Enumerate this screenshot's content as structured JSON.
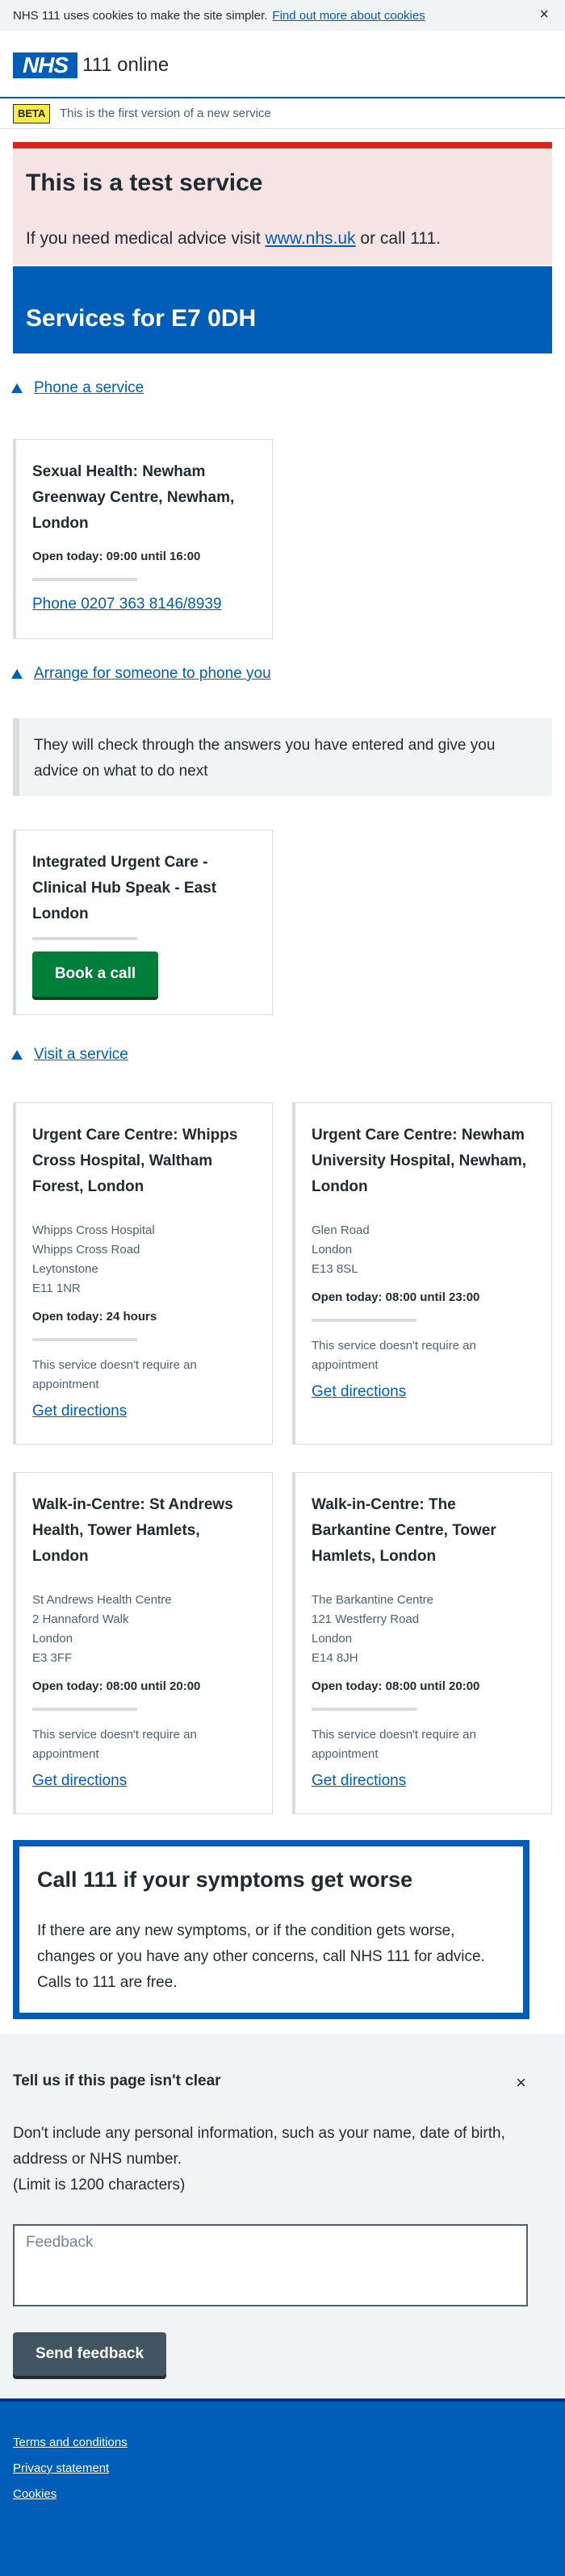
{
  "cookie_banner": {
    "text": "NHS 111 uses cookies to make the site simpler.",
    "link": "Find out more about cookies",
    "close": "×"
  },
  "header": {
    "logo": "NHS",
    "service_name": "111 online"
  },
  "beta": {
    "tag": "BETA",
    "text": "This is the first version of a new service"
  },
  "test_panel": {
    "title": "This is a test service",
    "text_before": "If you need medical advice visit",
    "link": "www.nhs.uk",
    "text_after": "or call 111."
  },
  "services_heading": "Services for E7 0DH",
  "phone_section": {
    "toggle": "Phone a service",
    "card": {
      "title": "Sexual Health: Newham Greenway Centre, Newham, London",
      "open": "Open today: 09:00 until 16:00",
      "phone_link": "Phone 0207 363 8146/8939"
    }
  },
  "arrange_section": {
    "toggle": "Arrange for someone to phone you",
    "inset": "They will check through the answers you have entered and give you advice on what to do next",
    "card": {
      "title": "Integrated Urgent Care - Clinical Hub Speak - East London",
      "button": "Book a call"
    }
  },
  "visit_section": {
    "toggle": "Visit a service",
    "cards": [
      {
        "title": "Urgent Care Centre: Whipps Cross Hospital, Waltham Forest, London",
        "address": [
          "Whipps Cross Hospital",
          "Whipps Cross Road",
          "Leytonstone",
          "E11 1NR"
        ],
        "open": "Open today: 24 hours",
        "note": "This service doesn't require an appointment",
        "link": "Get directions"
      },
      {
        "title": "Urgent Care Centre: Newham University Hospital, Newham, London",
        "address": [
          "Glen Road",
          "London",
          "E13 8SL"
        ],
        "open": "Open today: 08:00 until 23:00",
        "note": "This service doesn't require an appointment",
        "link": "Get directions"
      },
      {
        "title": "Walk-in-Centre: St Andrews Health, Tower Hamlets, London",
        "address": [
          "St Andrews Health Centre",
          "2 Hannaford Walk",
          "London",
          "E3 3FF"
        ],
        "open": "Open today: 08:00 until 20:00",
        "note": "This service doesn't require an appointment",
        "link": "Get directions"
      },
      {
        "title": "Walk-in-Centre: The Barkantine Centre, Tower Hamlets, London",
        "address": [
          "The Barkantine Centre",
          "121 Westferry Road",
          "London",
          "E14 8JH"
        ],
        "open": "Open today: 08:00 until 20:00",
        "note": "This service doesn't require an appointment",
        "link": "Get directions"
      }
    ]
  },
  "call_box": {
    "title": "Call 111 if your symptoms get worse",
    "text": "If there are any new symptoms, or if the condition gets worse, changes or you have any other concerns, call NHS 111 for advice. Calls to 111 are free."
  },
  "feedback": {
    "title": "Tell us if this page isn't clear",
    "close": "×",
    "desc": "Don't include any personal information, such as your name, date of birth, address or NHS number.",
    "limit": "(Limit is 1200 characters)",
    "placeholder": "Feedback",
    "send": "Send feedback"
  },
  "footer": {
    "links": [
      "Terms and conditions",
      "Privacy statement",
      "Cookies"
    ]
  },
  "colors": {
    "nhs_blue": "#005eb8",
    "green_button": "#007f3b",
    "red_border": "#d5281b",
    "panel_pink": "#f5e4e3",
    "beta_yellow": "#ffeb3b"
  }
}
